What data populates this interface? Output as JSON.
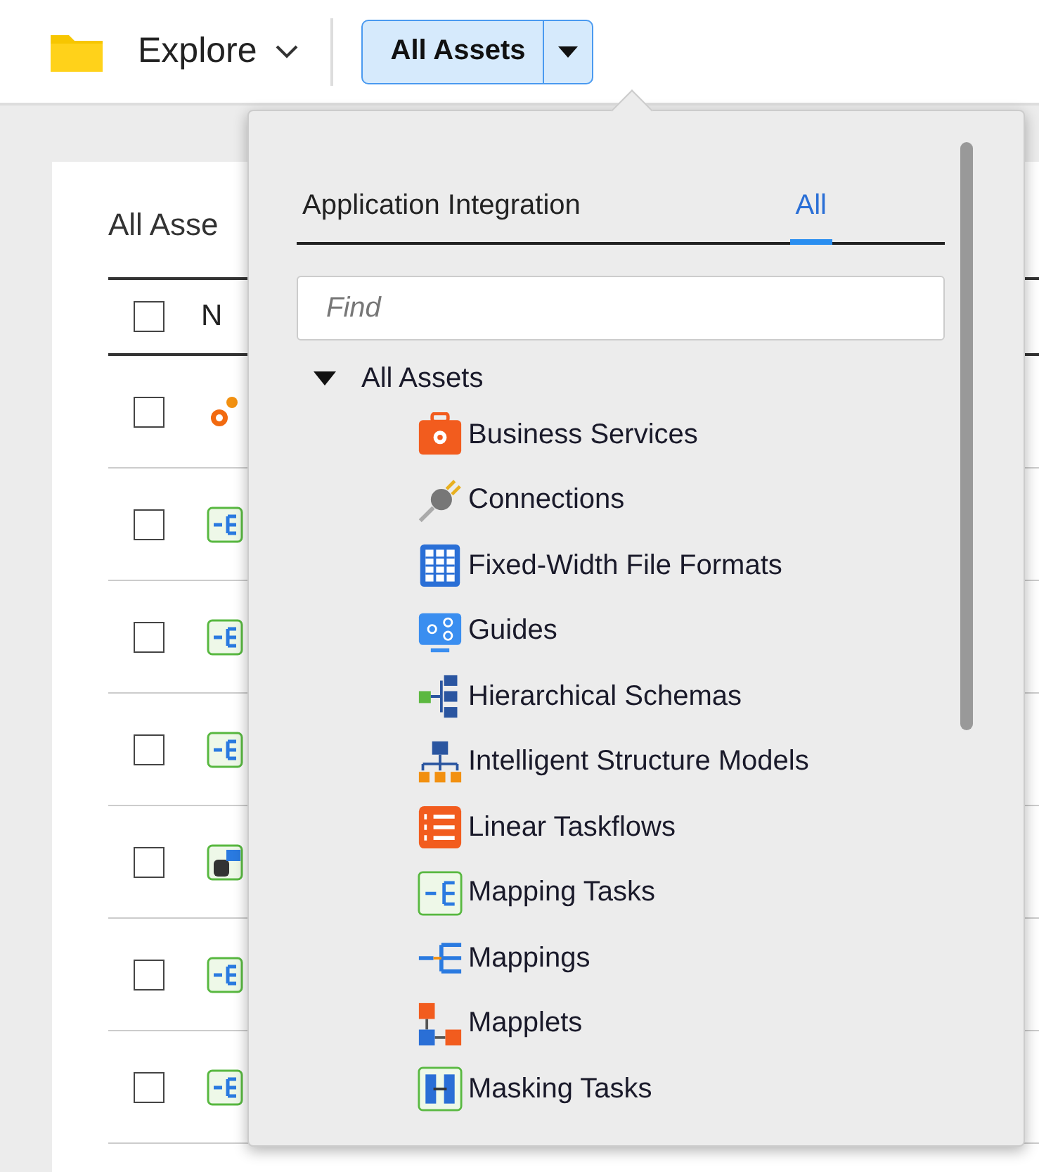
{
  "toolbar": {
    "section": "Explore",
    "asset_filter": "All Assets"
  },
  "card": {
    "title": "All Asse",
    "columns": [
      {
        "label": "N"
      }
    ],
    "header_checked": false,
    "rows": [
      {
        "kind": "gear",
        "checked": false
      },
      {
        "kind": "mapping-task",
        "checked": false
      },
      {
        "kind": "mapping-task",
        "checked": false
      },
      {
        "kind": "mapping-task",
        "checked": false
      },
      {
        "kind": "data-task",
        "checked": false
      },
      {
        "kind": "mapping-task",
        "checked": false
      },
      {
        "kind": "mapping-task",
        "checked": false
      }
    ]
  },
  "dropdown": {
    "tabs": [
      {
        "label": "Application Integration",
        "selected": false
      },
      {
        "label": "All",
        "selected": true
      }
    ],
    "search": {
      "placeholder": "Find"
    },
    "tree": {
      "label": "All Assets",
      "expanded": true,
      "children": [
        {
          "label": "Business Services",
          "kind": "business-service"
        },
        {
          "label": "Connections",
          "kind": "connection"
        },
        {
          "label": "Fixed-Width File Formats",
          "kind": "fixed-width"
        },
        {
          "label": "Guides",
          "kind": "guide"
        },
        {
          "label": "Hierarchical Schemas",
          "kind": "hierarchical-schema"
        },
        {
          "label": "Intelligent Structure Models",
          "kind": "intelligent-structure"
        },
        {
          "label": "Linear Taskflows",
          "kind": "linear-taskflow"
        },
        {
          "label": "Mapping Tasks",
          "kind": "mapping-task"
        },
        {
          "label": "Mappings",
          "kind": "mapping"
        },
        {
          "label": "Mapplets",
          "kind": "mapplet"
        },
        {
          "label": "Masking Tasks",
          "kind": "masking-task"
        }
      ]
    }
  }
}
